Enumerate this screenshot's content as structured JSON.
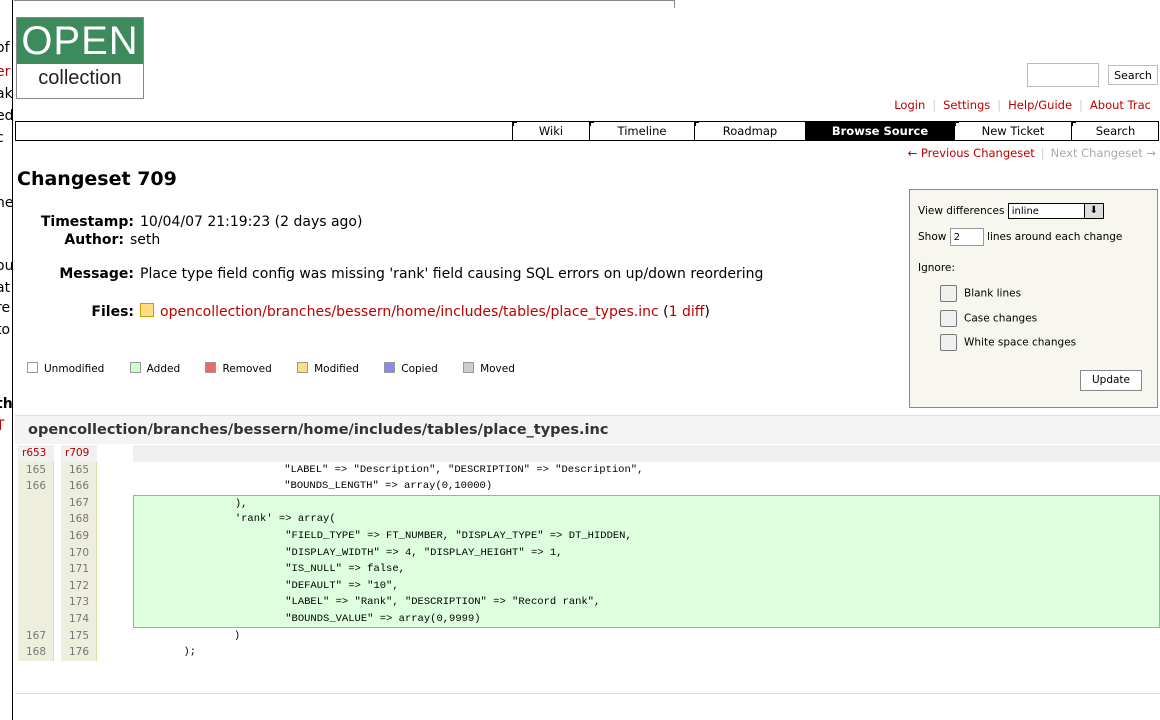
{
  "left_fragments": [
    "of",
    "er",
    "ak",
    "ed",
    "c",
    "ne",
    "ou",
    "at",
    "re",
    "to",
    "th",
    "T"
  ],
  "logo": {
    "line1": "OPEN",
    "line2": "collection"
  },
  "search": {
    "button": "Search"
  },
  "metanav": [
    "Login",
    "Settings",
    "Help/Guide",
    "About Trac"
  ],
  "mainnav": [
    {
      "label": "Wiki",
      "active": false
    },
    {
      "label": "Timeline",
      "active": false
    },
    {
      "label": "Roadmap",
      "active": false
    },
    {
      "label": "Browse Source",
      "active": true
    },
    {
      "label": "New Ticket",
      "active": false
    },
    {
      "label": "Search",
      "active": false
    }
  ],
  "changeset_nav": {
    "prev": "← Previous Changeset",
    "next": "Next Changeset →"
  },
  "title": "Changeset 709",
  "props": {
    "timestamp_label": "Timestamp:",
    "timestamp": "10/04/07 21:19:23 (2 days ago)",
    "author_label": "Author:",
    "author": "seth",
    "message_label": "Message:",
    "message": "Place type field config was missing 'rank' field causing SQL errors on up/down reordering",
    "files_label": "Files:",
    "file_path": "opencollection/branches/bessern/home/includes/tables/place_types.inc",
    "diff_link": "1 diff"
  },
  "legend": [
    {
      "label": "Unmodified",
      "color": "#ffffff"
    },
    {
      "label": "Added",
      "color": "#ccffcc"
    },
    {
      "label": "Removed",
      "color": "#ee6666"
    },
    {
      "label": "Modified",
      "color": "#ffdd88"
    },
    {
      "label": "Copied",
      "color": "#8888ee"
    },
    {
      "label": "Moved",
      "color": "#cccccc"
    }
  ],
  "diff_options": {
    "view_label": "View differences",
    "view_value": "inline",
    "show_label": "Show",
    "show_value": "2",
    "lines_label": "lines around each change",
    "ignore_label": "Ignore:",
    "blank_lines": "Blank lines",
    "case_changes": "Case changes",
    "whitespace_changes": "White space changes",
    "update_button": "Update"
  },
  "diff": {
    "file": "opencollection/branches/bessern/home/includes/tables/place_types.inc",
    "old_rev": "r653",
    "new_rev": "r709",
    "rows": [
      {
        "old": "165",
        "new": "165",
        "type": "context",
        "code": "                        \"LABEL\" => \"Description\", \"DESCRIPTION\" => \"Description\","
      },
      {
        "old": "166",
        "new": "166",
        "type": "context",
        "code": "                        \"BOUNDS_LENGTH\" => array(0,10000)"
      },
      {
        "old": "",
        "new": "167",
        "type": "added",
        "code": "                ),"
      },
      {
        "old": "",
        "new": "168",
        "type": "added",
        "code": "                'rank' => array("
      },
      {
        "old": "",
        "new": "169",
        "type": "added",
        "code": "                        \"FIELD_TYPE\" => FT_NUMBER, \"DISPLAY_TYPE\" => DT_HIDDEN,"
      },
      {
        "old": "",
        "new": "170",
        "type": "added",
        "code": "                        \"DISPLAY_WIDTH\" => 4, \"DISPLAY_HEIGHT\" => 1,"
      },
      {
        "old": "",
        "new": "171",
        "type": "added",
        "code": "                        \"IS_NULL\" => false,"
      },
      {
        "old": "",
        "new": "172",
        "type": "added",
        "code": "                        \"DEFAULT\" => \"10\","
      },
      {
        "old": "",
        "new": "173",
        "type": "added",
        "code": "                        \"LABEL\" => \"Rank\", \"DESCRIPTION\" => \"Record rank\","
      },
      {
        "old": "",
        "new": "174",
        "type": "added",
        "code": "                        \"BOUNDS_VALUE\" => array(0,9999)"
      },
      {
        "old": "167",
        "new": "175",
        "type": "context",
        "code": "                )"
      },
      {
        "old": "168",
        "new": "176",
        "type": "context",
        "code": "        );"
      }
    ]
  }
}
